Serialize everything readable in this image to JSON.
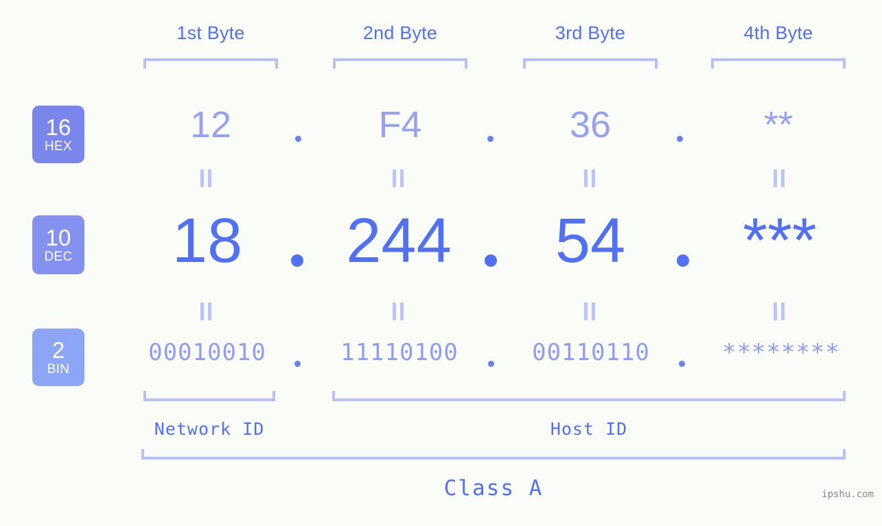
{
  "watermark": "ipshu.com",
  "byte_headers": [
    {
      "label": "1st Byte"
    },
    {
      "label": "2nd Byte"
    },
    {
      "label": "3rd Byte"
    },
    {
      "label": "4th Byte"
    }
  ],
  "bases": [
    {
      "number": "16",
      "name": "HEX",
      "color": "#7b86ec"
    },
    {
      "number": "10",
      "name": "DEC",
      "color": "#8591ee"
    },
    {
      "number": "2",
      "name": "BIN",
      "color": "#8ca6f5"
    }
  ],
  "rows": {
    "hex": {
      "base_number": "16",
      "base_name": "HEX",
      "values": [
        "12",
        "F4",
        "36",
        "**"
      ],
      "separator": "."
    },
    "dec": {
      "base_number": "10",
      "base_name": "DEC",
      "values": [
        "18",
        "244",
        "54",
        "***"
      ],
      "separator": "."
    },
    "bin": {
      "base_number": "2",
      "base_name": "BIN",
      "values": [
        "00010010",
        "11110100",
        "00110110",
        "********"
      ],
      "separator": "."
    }
  },
  "equals_glyph": "||",
  "segments": {
    "network_id": "Network ID",
    "host_id": "Host ID"
  },
  "class_label": "Class A",
  "colors": {
    "background": "#fafdf7",
    "accent_strong": "#5271f2",
    "accent_light": "#96a2f0",
    "bracket": "#b7c0fb",
    "badge_hex": "#7b86ec",
    "badge_dec": "#8591ee",
    "badge_bin": "#8ca6f5",
    "watermark": "#8a8a8a"
  }
}
